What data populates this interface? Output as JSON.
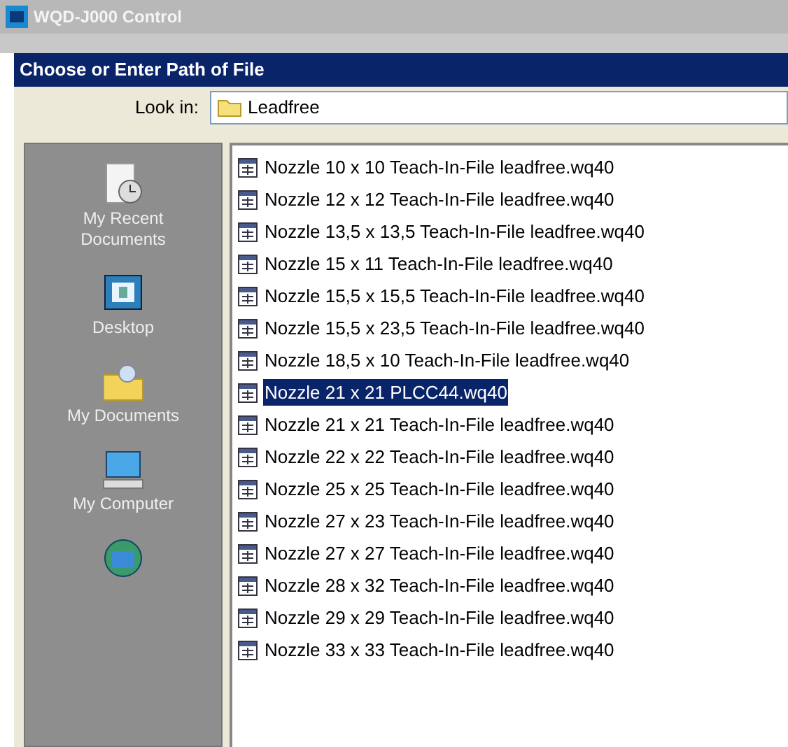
{
  "window": {
    "title": "WQD-J000 Control"
  },
  "dialog": {
    "title": "Choose or Enter Path of File"
  },
  "look_in": {
    "label": "Look in:",
    "value": "Leadfree"
  },
  "places": [
    {
      "kind": "recent",
      "label": "My Recent Documents"
    },
    {
      "kind": "desktop",
      "label": "Desktop"
    },
    {
      "kind": "documents",
      "label": "My Documents"
    },
    {
      "kind": "computer",
      "label": "My Computer"
    },
    {
      "kind": "network"
    }
  ],
  "files": [
    {
      "name": "Nozzle 10 x 10 Teach-In-File leadfree.wq40",
      "selected": false
    },
    {
      "name": "Nozzle 12 x 12 Teach-In-File leadfree.wq40",
      "selected": false
    },
    {
      "name": "Nozzle 13,5 x 13,5 Teach-In-File leadfree.wq40",
      "selected": false
    },
    {
      "name": "Nozzle 15 x 11 Teach-In-File leadfree.wq40",
      "selected": false
    },
    {
      "name": "Nozzle 15,5 x 15,5 Teach-In-File leadfree.wq40",
      "selected": false
    },
    {
      "name": "Nozzle 15,5 x 23,5 Teach-In-File leadfree.wq40",
      "selected": false
    },
    {
      "name": "Nozzle 18,5 x 10 Teach-In-File leadfree.wq40",
      "selected": false
    },
    {
      "name": "Nozzle 21 x 21 PLCC44.wq40",
      "selected": true
    },
    {
      "name": "Nozzle 21 x 21 Teach-In-File leadfree.wq40",
      "selected": false
    },
    {
      "name": "Nozzle 22 x 22 Teach-In-File leadfree.wq40",
      "selected": false
    },
    {
      "name": "Nozzle 25 x 25 Teach-In-File leadfree.wq40",
      "selected": false
    },
    {
      "name": "Nozzle 27 x 23 Teach-In-File leadfree.wq40",
      "selected": false
    },
    {
      "name": "Nozzle 27 x 27 Teach-In-File leadfree.wq40",
      "selected": false
    },
    {
      "name": "Nozzle 28 x 32 Teach-In-File leadfree.wq40",
      "selected": false
    },
    {
      "name": "Nozzle 29 x 29 Teach-In-File leadfree.wq40",
      "selected": false
    },
    {
      "name": "Nozzle 33 x 33 Teach-In-File leadfree.wq40",
      "selected": false
    }
  ]
}
